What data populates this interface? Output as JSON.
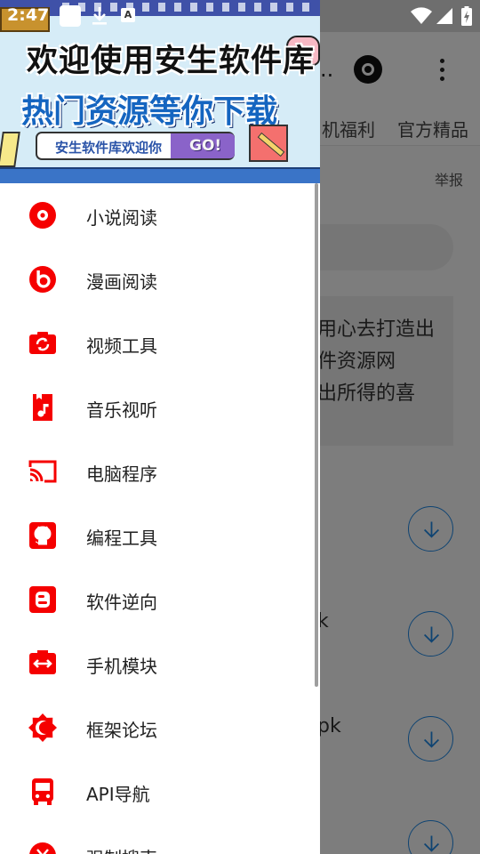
{
  "status_bar": {
    "time": "2:47",
    "a_badge": "A"
  },
  "background_app": {
    "title_partial": "..",
    "tabs": [
      "机福利",
      "官方精品"
    ],
    "report_label": "举报",
    "notice_lines": [
      "用心去打造出",
      "件资源网",
      "出所得的喜"
    ],
    "row_fragments": [
      "k",
      "pk"
    ]
  },
  "drawer": {
    "banner": {
      "headline": "欢迎使用安生软件库",
      "subline": "热门资源等你下载",
      "welcome": "安生软件库欢迎你",
      "go": "GO!"
    },
    "menu": [
      {
        "label": "小说阅读",
        "icon": "record-disc-icon"
      },
      {
        "label": "漫画阅读",
        "icon": "beats-logo-icon"
      },
      {
        "label": "视频工具",
        "icon": "camera-switch-icon"
      },
      {
        "label": "音乐视听",
        "icon": "music-file-icon"
      },
      {
        "label": "电脑程序",
        "icon": "cast-icon"
      },
      {
        "label": "编程工具",
        "icon": "github-icon"
      },
      {
        "label": "软件逆向",
        "icon": "blogger-icon"
      },
      {
        "label": "手机模块",
        "icon": "horizontal-arrows-icon"
      },
      {
        "label": "框架论坛",
        "icon": "brightness-icon"
      },
      {
        "label": "API导航",
        "icon": "bus-icon"
      },
      {
        "label": "强制搜索",
        "icon": "money-icon"
      }
    ],
    "accent_color": "#f50000"
  }
}
